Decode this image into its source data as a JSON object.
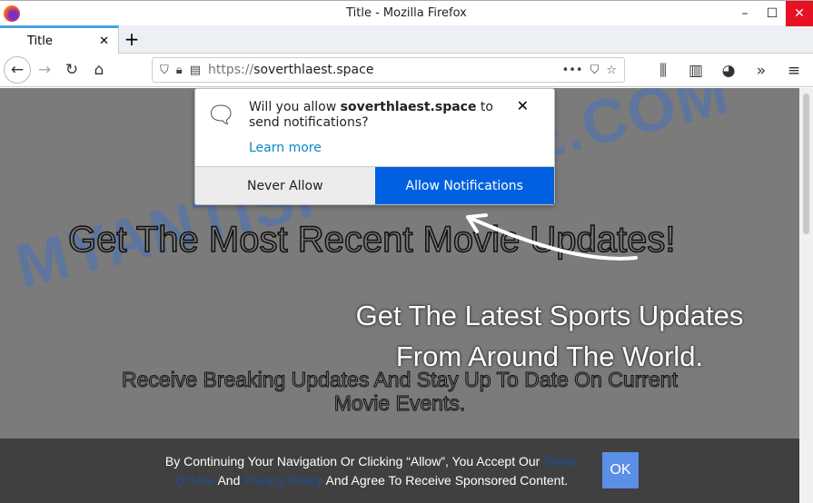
{
  "window": {
    "title": "Title - Mozilla Firefox"
  },
  "tab": {
    "label": "Title"
  },
  "address": {
    "scheme": "https://",
    "host": "soverthlaest.space"
  },
  "popup": {
    "prefix": "Will you allow ",
    "site": "soverthlaest.space",
    "suffix": " to send notifications?",
    "learn_more": "Learn more",
    "never": "Never Allow",
    "allow": "Allow Notifications"
  },
  "page": {
    "watermark": "MYANTISPYWARE.COM",
    "headline": "Get The Most Recent Movie Updates!",
    "sports": "Get The Latest Sports Updates From Around The World.",
    "sub": "Receive Breaking Updates And Stay Up To Date On Current Movie Events."
  },
  "consent": {
    "t1": "By Continuing Your Navigation Or Clicking “Allow”, You Accept Our ",
    "terms": "Terms Of Use",
    "t2": " And ",
    "privacy": "Privacy Policy",
    "t3": " And Agree To Receive Sponsored Content.",
    "ok": "OK"
  },
  "colors": {
    "allow_button": "#0061e0",
    "page_bg": "#7b7b7b",
    "ok_button": "#5b8fe6"
  }
}
